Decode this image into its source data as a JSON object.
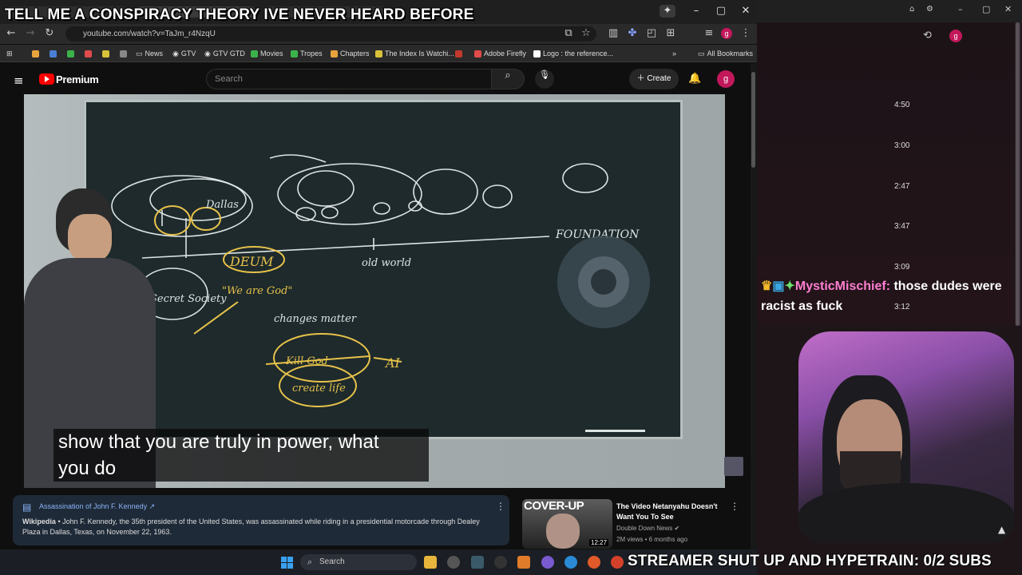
{
  "stream": {
    "title_overlay": "TELL ME A CONSPIRACY THEORY IVE NEVER HEARD BEFORE",
    "ticker": "STREAMER SHUT UP AND HYPETRAIN: 0/2 SUBS"
  },
  "browser": {
    "url": "youtube.com/watch?v=TaJm_r4NzqU",
    "bookmarks": [
      "News",
      "GTV",
      "GTV GTD",
      "Movies",
      "Tropes",
      "Chapters",
      "The Index Is Watchi...",
      "Adobe Firefly",
      "Logo : the reference...",
      "All Bookmarks"
    ]
  },
  "youtube": {
    "logo_label": "Premium",
    "search_placeholder": "Search",
    "create_label": "Create",
    "avatar_letter": "g",
    "caption_line1": "show that you are truly in power, what",
    "caption_line2": "you do",
    "info_panel": {
      "link_title": "Assassination of John F. Kennedy",
      "source": "Wikipedia",
      "text": " • John F. Kennedy, the 35th president of the United States, was assassinated while riding in a presidential motorcade through Dealey Plaza in Dallas, Texas, on November 22, 1963."
    },
    "recommendation": {
      "thumb_text": "COVER-UP",
      "duration": "12:27",
      "title": "The Video Netanyahu Doesn't Want You To See",
      "channel": "Double Down News",
      "meta": "2M views • 6 months ago"
    }
  },
  "board_text": {
    "words": [
      "DEUM",
      "\"We are God\"",
      "Secret Society",
      "changes matter",
      "Kill God",
      "create life",
      "AI",
      "old world",
      "Dallas",
      "FOUNDATION"
    ]
  },
  "chat": {
    "timestamps": [
      "4:50",
      "3:00",
      "2:47",
      "3:47",
      "3:09",
      "3:12"
    ],
    "message_user": "MysticMischief:",
    "message_text": " those dudes were racist as fuck",
    "avatar_letter": "g"
  },
  "taskbar": {
    "search_label": "Search"
  },
  "colors": {
    "youtube_red": "#ff0000",
    "chat_user": "#ff7fd1",
    "avatar": "#c2185b"
  }
}
